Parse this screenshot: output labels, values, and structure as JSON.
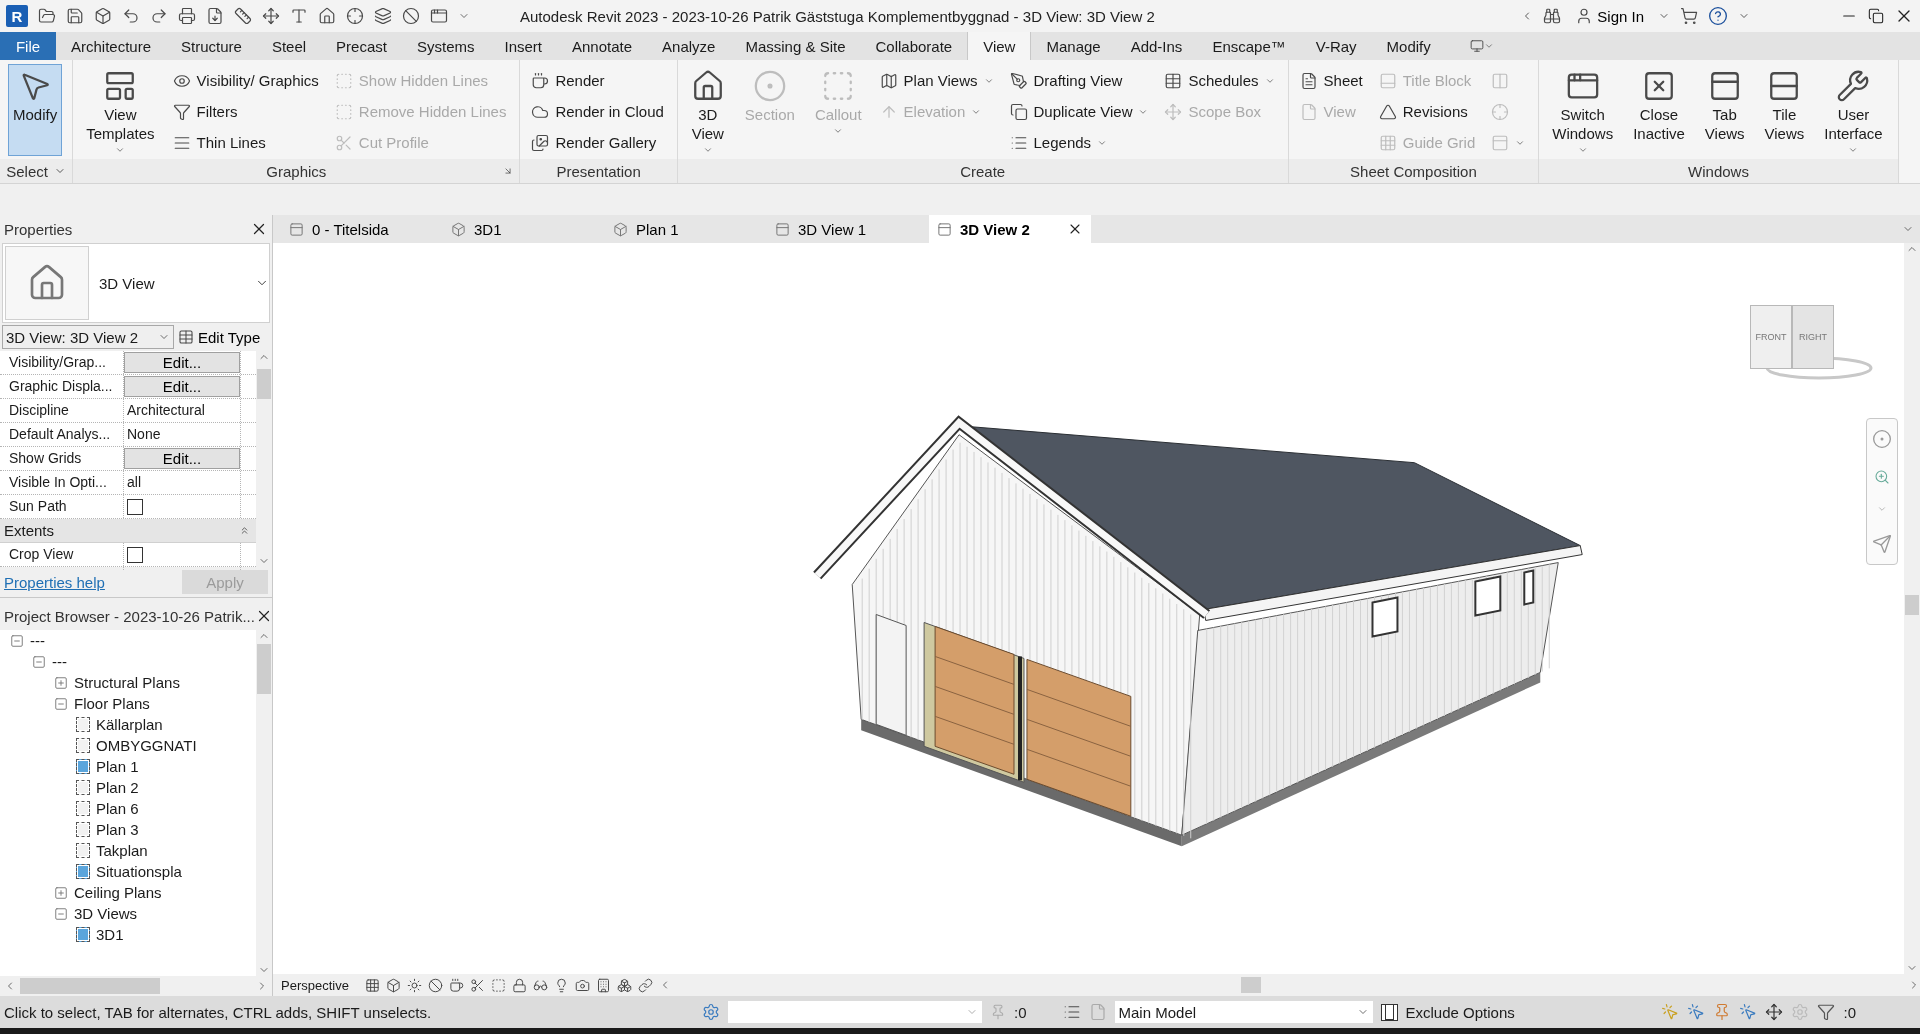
{
  "app": {
    "logo": "R",
    "title": "Autodesk Revit 2023 - 2023-10-26 Patrik Gäststuga Komplementbyggnad - 3D View: 3D View 2",
    "sign_in": "Sign In"
  },
  "ribbon_tabs": [
    {
      "label": "File",
      "kind": "app",
      "selected": false
    },
    {
      "label": "Architecture",
      "kind": "tab",
      "selected": false
    },
    {
      "label": "Structure",
      "kind": "tab",
      "selected": false
    },
    {
      "label": "Steel",
      "kind": "tab",
      "selected": false
    },
    {
      "label": "Precast",
      "kind": "tab",
      "selected": false
    },
    {
      "label": "Systems",
      "kind": "tab",
      "selected": false
    },
    {
      "label": "Insert",
      "kind": "tab",
      "selected": false
    },
    {
      "label": "Annotate",
      "kind": "tab",
      "selected": false
    },
    {
      "label": "Analyze",
      "kind": "tab",
      "selected": false
    },
    {
      "label": "Massing & Site",
      "kind": "tab",
      "selected": false
    },
    {
      "label": "Collaborate",
      "kind": "tab",
      "selected": false
    },
    {
      "label": "View",
      "kind": "tab",
      "selected": true
    },
    {
      "label": "Manage",
      "kind": "tab",
      "selected": false
    },
    {
      "label": "Add-Ins",
      "kind": "tab",
      "selected": false
    },
    {
      "label": "Enscape™",
      "kind": "tab",
      "selected": false
    },
    {
      "label": "V-Ray",
      "kind": "tab",
      "selected": false
    },
    {
      "label": "Modify",
      "kind": "tab",
      "selected": false
    }
  ],
  "ribbon_panels": [
    {
      "title": "Select",
      "title_dropdown": true,
      "launcher": false,
      "columns": [
        {
          "kind": "large",
          "tools": [
            {
              "label": "Modify",
              "active": true,
              "disabled": false,
              "dropdown": false
            }
          ]
        }
      ]
    },
    {
      "title": "Graphics",
      "title_dropdown": false,
      "launcher": true,
      "columns": [
        {
          "kind": "large",
          "tools": [
            {
              "label": "View Templates",
              "active": false,
              "disabled": false,
              "dropdown": true
            }
          ]
        },
        {
          "kind": "stack",
          "tools": [
            {
              "label": "Visibility/ Graphics",
              "active": false,
              "disabled": false,
              "dropdown": false
            },
            {
              "label": "Filters",
              "active": false,
              "disabled": false,
              "dropdown": false
            },
            {
              "label": "Thin Lines",
              "active": false,
              "disabled": false,
              "dropdown": false
            }
          ]
        },
        {
          "kind": "stack",
          "tools": [
            {
              "label": "Show Hidden Lines",
              "active": false,
              "disabled": true,
              "dropdown": false
            },
            {
              "label": "Remove Hidden Lines",
              "active": false,
              "disabled": true,
              "dropdown": false
            },
            {
              "label": "Cut Profile",
              "active": false,
              "disabled": true,
              "dropdown": false
            }
          ]
        }
      ]
    },
    {
      "title": "Presentation",
      "title_dropdown": false,
      "launcher": false,
      "columns": [
        {
          "kind": "stack",
          "tools": [
            {
              "label": "Render",
              "active": false,
              "disabled": false,
              "dropdown": false
            },
            {
              "label": "Render in Cloud",
              "active": false,
              "disabled": false,
              "dropdown": false
            },
            {
              "label": "Render Gallery",
              "active": false,
              "disabled": false,
              "dropdown": false
            }
          ]
        }
      ]
    },
    {
      "title": "Create",
      "title_dropdown": false,
      "launcher": false,
      "columns": [
        {
          "kind": "large",
          "tools": [
            {
              "label": "3D View",
              "active": false,
              "disabled": false,
              "dropdown": true
            }
          ]
        },
        {
          "kind": "large",
          "tools": [
            {
              "label": "Section",
              "active": false,
              "disabled": true,
              "dropdown": false
            }
          ]
        },
        {
          "kind": "large",
          "tools": [
            {
              "label": "Callout",
              "active": false,
              "disabled": true,
              "dropdown": true
            }
          ]
        },
        {
          "kind": "stack",
          "tools": [
            {
              "label": "Plan Views",
              "active": false,
              "disabled": false,
              "dropdown": true
            },
            {
              "label": "Elevation",
              "active": false,
              "disabled": true,
              "dropdown": true
            }
          ]
        },
        {
          "kind": "stack",
          "tools": [
            {
              "label": "Drafting View",
              "active": false,
              "disabled": false,
              "dropdown": false
            },
            {
              "label": "Duplicate View",
              "active": false,
              "disabled": false,
              "dropdown": true
            },
            {
              "label": "Legends",
              "active": false,
              "disabled": false,
              "dropdown": true
            }
          ]
        },
        {
          "kind": "stack",
          "tools": [
            {
              "label": "Schedules",
              "active": false,
              "disabled": false,
              "dropdown": true
            },
            {
              "label": "Scope Box",
              "active": false,
              "disabled": true,
              "dropdown": false
            }
          ]
        }
      ]
    },
    {
      "title": "Sheet Composition",
      "title_dropdown": false,
      "launcher": false,
      "columns": [
        {
          "kind": "stack",
          "tools": [
            {
              "label": "Sheet",
              "active": false,
              "disabled": false,
              "dropdown": false
            },
            {
              "label": "View",
              "active": false,
              "disabled": true,
              "dropdown": false
            }
          ]
        },
        {
          "kind": "stack",
          "tools": [
            {
              "label": "Title Block",
              "active": false,
              "disabled": true,
              "dropdown": false
            },
            {
              "label": "Revisions",
              "active": false,
              "disabled": false,
              "dropdown": false
            },
            {
              "label": "Guide Grid",
              "active": false,
              "disabled": true,
              "dropdown": false
            }
          ]
        },
        {
          "kind": "stack",
          "tools": [
            {
              "active": false,
              "disabled": true,
              "dropdown": false
            },
            {
              "active": false,
              "disabled": true,
              "dropdown": false
            },
            {
              "active": false,
              "disabled": true,
              "dropdown": true
            }
          ]
        }
      ]
    },
    {
      "title": "Windows",
      "title_dropdown": false,
      "launcher": false,
      "columns": [
        {
          "kind": "large",
          "tools": [
            {
              "label": "Switch Windows",
              "active": false,
              "disabled": false,
              "dropdown": true
            }
          ]
        },
        {
          "kind": "large",
          "tools": [
            {
              "label": "Close Inactive",
              "active": false,
              "disabled": false,
              "dropdown": false
            }
          ]
        },
        {
          "kind": "large",
          "tools": [
            {
              "label": "Tab Views",
              "active": false,
              "disabled": false,
              "dropdown": false
            }
          ]
        },
        {
          "kind": "large",
          "tools": [
            {
              "label": "Tile Views",
              "active": false,
              "disabled": false,
              "dropdown": false
            }
          ]
        },
        {
          "kind": "large",
          "tools": [
            {
              "label": "User Interface",
              "active": false,
              "disabled": false,
              "dropdown": true
            }
          ]
        }
      ]
    }
  ],
  "properties": {
    "title": "Properties",
    "type_name": "3D View",
    "instance": "3D View: 3D View 2",
    "edit_type": "Edit Type",
    "rows": [
      {
        "kind": "button",
        "name": "Visibility/Grap...",
        "value": "Edit..."
      },
      {
        "kind": "button",
        "name": "Graphic Displa...",
        "value": "Edit..."
      },
      {
        "kind": "text",
        "name": "Discipline",
        "value": "Architectural"
      },
      {
        "kind": "text",
        "name": "Default Analys...",
        "value": "None"
      },
      {
        "kind": "button",
        "name": "Show Grids",
        "value": "Edit..."
      },
      {
        "kind": "text",
        "name": "Visible In Opti...",
        "value": "all"
      },
      {
        "kind": "checkbox",
        "name": "Sun Path",
        "checked": false
      },
      {
        "kind": "group",
        "name": "Extents"
      },
      {
        "kind": "checkbox",
        "name": "Crop View",
        "checked": false
      }
    ],
    "help": "Properties help",
    "apply": {
      "label": "Apply",
      "disabled": true
    }
  },
  "project_browser": {
    "title": "Project Browser - 2023-10-26 Patrik...",
    "tree": [
      {
        "kind": "group",
        "label": "---",
        "expanded": true,
        "children": [
          {
            "kind": "group",
            "label": "---",
            "expanded": true,
            "children": [
              {
                "kind": "group",
                "label": "Structural Plans",
                "expanded": false
              },
              {
                "kind": "group",
                "label": "Floor Plans",
                "expanded": true,
                "children": [
                  {
                    "kind": "view",
                    "label": "Källarplan",
                    "open": false
                  },
                  {
                    "kind": "view",
                    "label": "OMBYGGNATI",
                    "open": false
                  },
                  {
                    "kind": "view",
                    "label": "Plan 1",
                    "open": true
                  },
                  {
                    "kind": "view",
                    "label": "Plan 2",
                    "open": false
                  },
                  {
                    "kind": "view",
                    "label": "Plan 6",
                    "open": false
                  },
                  {
                    "kind": "view",
                    "label": "Plan 3",
                    "open": false
                  },
                  {
                    "kind": "view",
                    "label": "Takplan",
                    "open": false
                  },
                  {
                    "kind": "view",
                    "label": "Situationspla",
                    "open": true
                  }
                ]
              },
              {
                "kind": "group",
                "label": "Ceiling Plans",
                "expanded": false
              },
              {
                "kind": "group",
                "label": "3D Views",
                "expanded": true,
                "children": [
                  {
                    "kind": "view",
                    "label": "3D1",
                    "open": true
                  }
                ]
              }
            ]
          }
        ]
      }
    ]
  },
  "view_tabs": [
    {
      "label": "0 - Titelsida",
      "selected": false
    },
    {
      "label": "3D1",
      "selected": false
    },
    {
      "label": "Plan 1",
      "selected": false
    },
    {
      "label": "3D View 1",
      "selected": false
    },
    {
      "label": "3D View 2",
      "selected": true
    }
  ],
  "viewcube": {
    "front": "FRONT",
    "right": "RIGHT"
  },
  "view_control": {
    "projection": "Perspective"
  },
  "status_bar": {
    "message": "Click to select, TAB for alternates, CTRL adds, SHIFT unselects.",
    "link_count": ":0",
    "workset": "Main Model",
    "exclude_options": {
      "label": "Exclude Options",
      "checked": true
    },
    "filter_count": ":0"
  }
}
